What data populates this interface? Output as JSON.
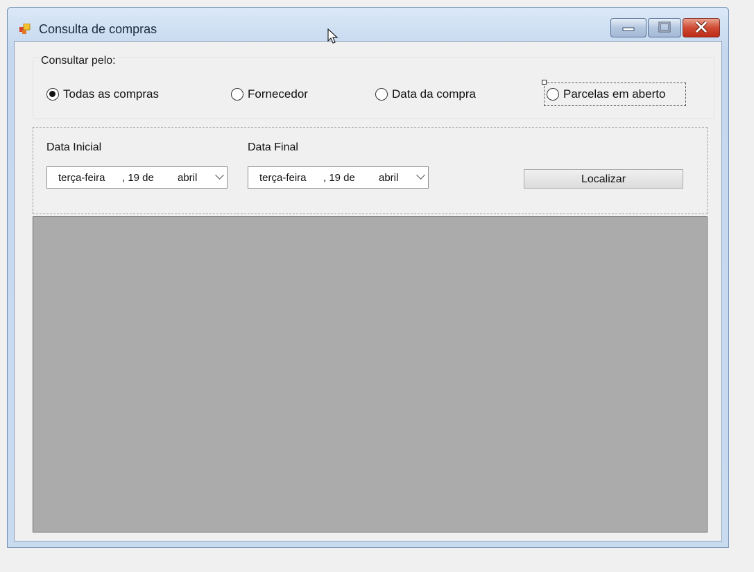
{
  "window": {
    "title": "Consulta de compras",
    "icon": "app-form-icon"
  },
  "caption_buttons": [
    "minimize-icon",
    "maximize-icon",
    "close-icon"
  ],
  "filter_group": {
    "label": "Consultar pelo:",
    "options": [
      {
        "label": "Todas as compras",
        "checked": true
      },
      {
        "label": "Fornecedor",
        "checked": false
      },
      {
        "label": "Data da compra",
        "checked": false
      },
      {
        "label": "Parcelas em aberto",
        "checked": false
      }
    ]
  },
  "date_panel": {
    "start_label": "Data Inicial",
    "end_label": "Data Final",
    "start_date": {
      "weekday": "terça-feira",
      "day": ", 19 de",
      "month": "abril"
    },
    "end_date": {
      "weekday": "terça-feira",
      "day": ", 19 de",
      "month": "abril"
    },
    "search_button": "Localizar"
  },
  "results_grid": {
    "background": "#ababab"
  },
  "colors": {
    "close_button": "#c9412b",
    "client_bg": "#f0f0f0"
  }
}
